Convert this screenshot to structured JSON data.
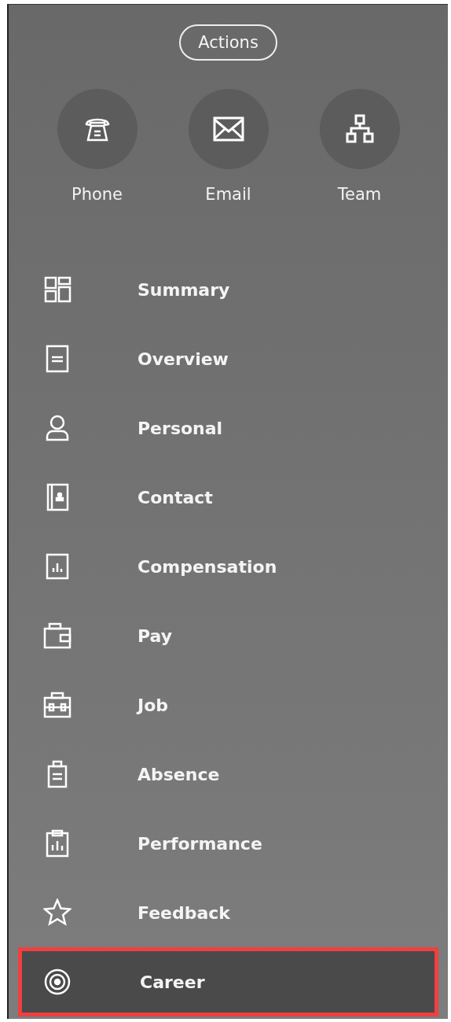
{
  "actions_button": "Actions",
  "quick_actions": [
    {
      "label": "Phone"
    },
    {
      "label": "Email"
    },
    {
      "label": "Team"
    }
  ],
  "menu": [
    {
      "label": "Summary",
      "selected": false
    },
    {
      "label": "Overview",
      "selected": false
    },
    {
      "label": "Personal",
      "selected": false
    },
    {
      "label": "Contact",
      "selected": false
    },
    {
      "label": "Compensation",
      "selected": false
    },
    {
      "label": "Pay",
      "selected": false
    },
    {
      "label": "Job",
      "selected": false
    },
    {
      "label": "Absence",
      "selected": false
    },
    {
      "label": "Performance",
      "selected": false
    },
    {
      "label": "Feedback",
      "selected": false
    },
    {
      "label": "Career",
      "selected": true
    }
  ]
}
